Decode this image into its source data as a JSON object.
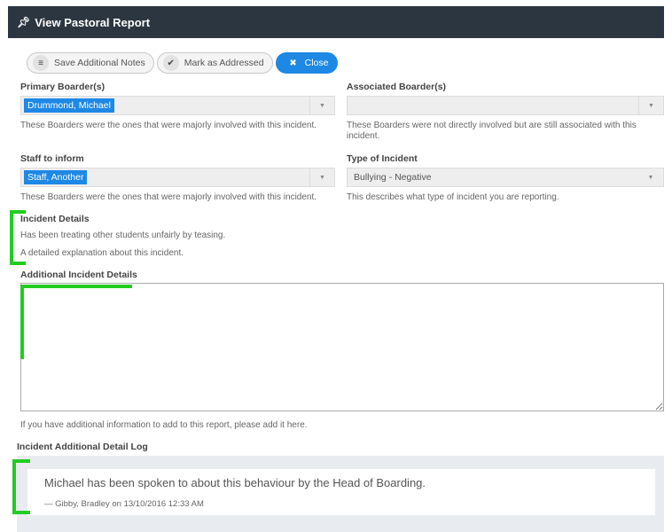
{
  "window": {
    "title": "View Pastoral Report"
  },
  "toolbar": {
    "save_notes": "Save Additional Notes",
    "mark_addressed": "Mark as Addressed",
    "close": "Close"
  },
  "primary_boarders": {
    "label": "Primary Boarder(s)",
    "selected": "Drummond, Michael",
    "help": "These Boarders were the ones that were majorly involved with this incident."
  },
  "associated_boarders": {
    "label": "Associated Boarder(s)",
    "selected": "",
    "help_line1": "These Boarders were not directly involved but are still associated with this",
    "help_line2": "incident."
  },
  "staff_to_inform": {
    "label": "Staff to inform",
    "selected": "Staff, Another",
    "help": "These Boarders were the ones that were majorly involved with this incident."
  },
  "type_of_incident": {
    "label": "Type of Incident",
    "selected": "Bullying - Negative",
    "help": "This describes what type of incident you are reporting."
  },
  "incident_details": {
    "label": "Incident Details",
    "value": "Has been treating other students unfairly by teasing.",
    "help": "A detailed explanation about this incident."
  },
  "additional_details": {
    "label": "Additional Incident Details",
    "value": "",
    "help": "If you have additional information to add to this report, please add it here."
  },
  "log": {
    "label": "Incident Additional Detail Log",
    "entries": [
      {
        "text": "Michael has been spoken to about this behaviour by the Head of Boarding.",
        "meta": "— Gibby, Bradley on 13/10/2016 12:33 AM"
      }
    ]
  },
  "colors": {
    "titlebar": "#2b3640",
    "accent": "#1e88e5",
    "highlight": "#22cc22"
  }
}
